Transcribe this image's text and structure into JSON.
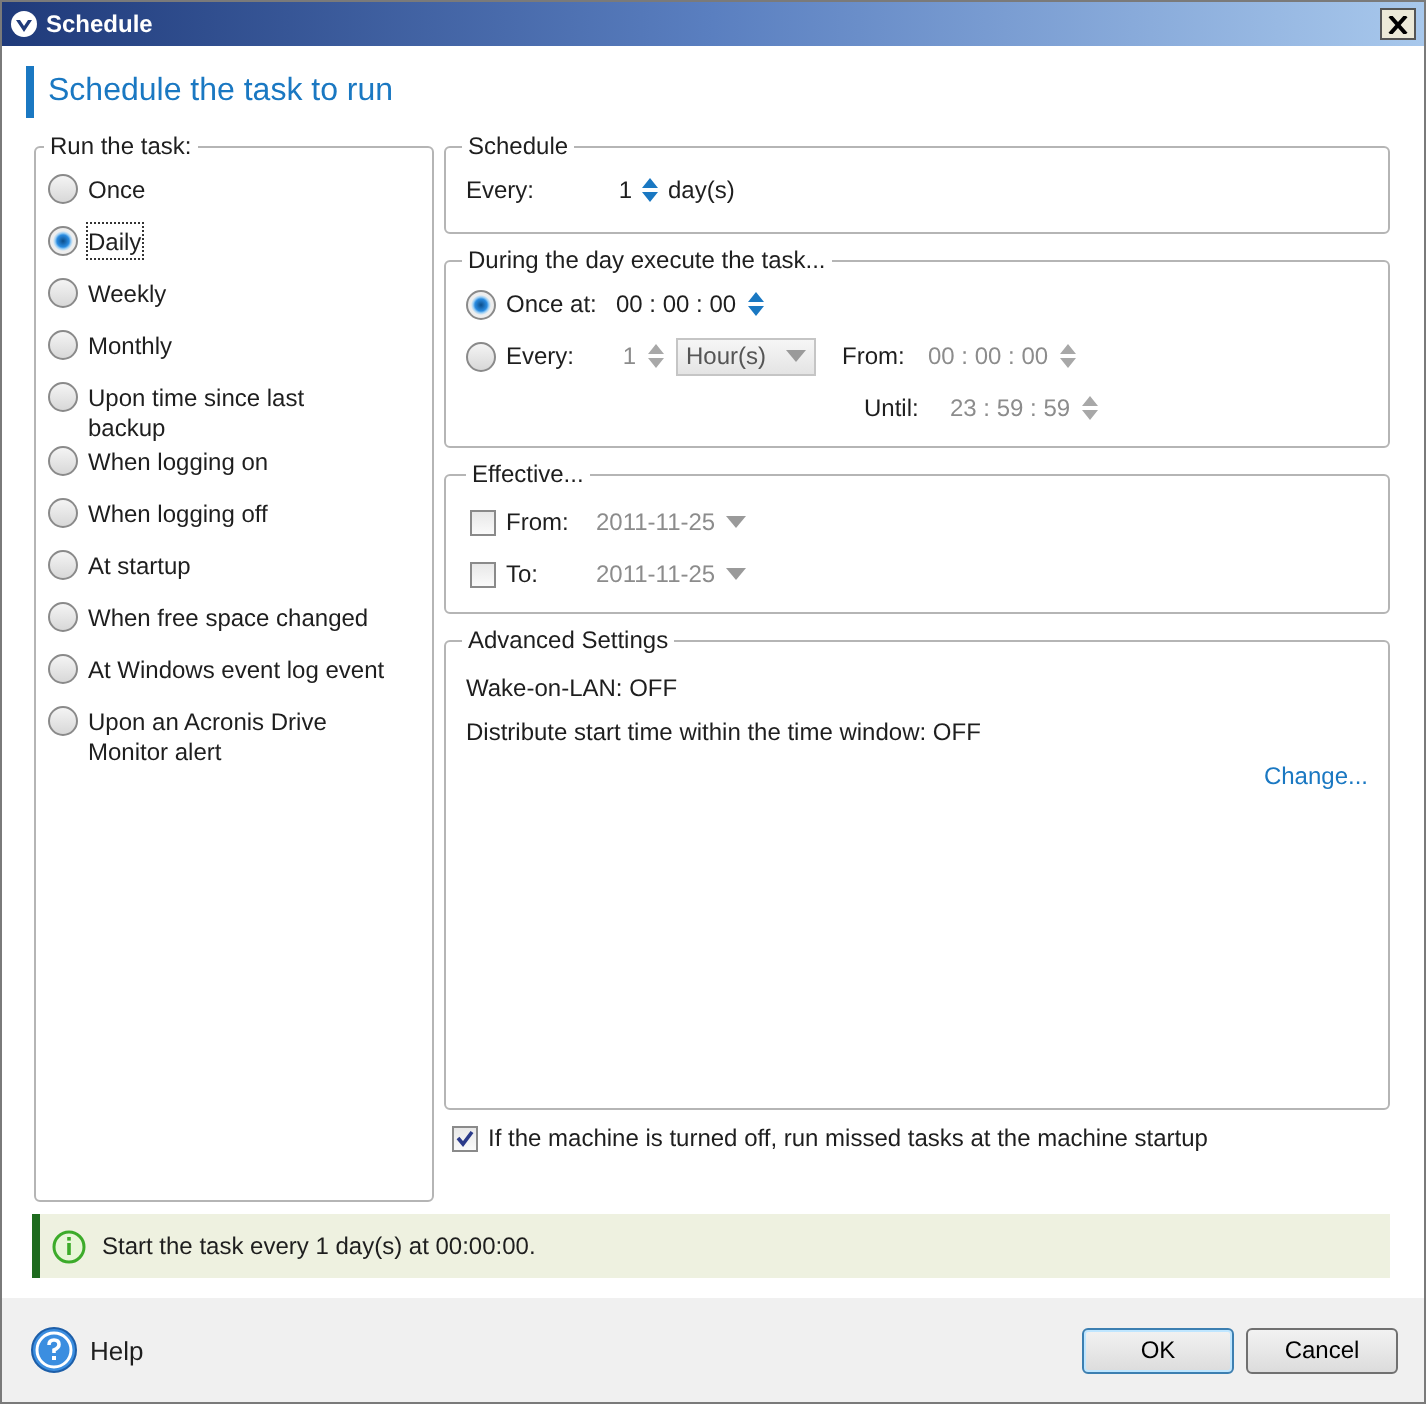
{
  "window": {
    "title": "Schedule"
  },
  "heading": "Schedule the task to run",
  "run_the_task": {
    "legend": "Run the task:",
    "options": [
      {
        "label": "Once",
        "selected": false
      },
      {
        "label": "Daily",
        "selected": true
      },
      {
        "label": "Weekly",
        "selected": false
      },
      {
        "label": "Monthly",
        "selected": false
      },
      {
        "label": "Upon time since last backup",
        "selected": false
      },
      {
        "label": "When logging on",
        "selected": false
      },
      {
        "label": "When logging off",
        "selected": false
      },
      {
        "label": "At startup",
        "selected": false
      },
      {
        "label": "When free space changed",
        "selected": false
      },
      {
        "label": "At Windows event log event",
        "selected": false
      },
      {
        "label": "Upon an Acronis Drive Monitor alert",
        "selected": false
      }
    ]
  },
  "schedule": {
    "legend": "Schedule",
    "every_label": "Every:",
    "every_value": "1",
    "unit": "day(s)"
  },
  "during_day": {
    "legend": "During the day execute the task...",
    "once_at": {
      "label": "Once at:",
      "selected": true,
      "time": "00 : 00 : 00"
    },
    "every": {
      "label": "Every:",
      "selected": false,
      "value": "1",
      "unit": "Hour(s)",
      "from_label": "From:",
      "from_time": "00 : 00 : 00",
      "until_label": "Until:",
      "until_time": "23 : 59 : 59"
    }
  },
  "effective": {
    "legend": "Effective...",
    "rows": [
      {
        "label": "From:",
        "checked": false,
        "date": "2011-11-25"
      },
      {
        "label": "To:",
        "checked": false,
        "date": "2011-11-25"
      }
    ]
  },
  "advanced": {
    "legend": "Advanced Settings",
    "lines": [
      "Wake-on-LAN: OFF",
      "Distribute start time within the time window: OFF"
    ],
    "link": "Change..."
  },
  "run_missed": {
    "label": "If the machine is turned off, run missed tasks at the machine startup",
    "checked": true
  },
  "summary": "Start the task every 1 day(s) at 00:00:00.",
  "footer": {
    "help": "Help",
    "buttons": [
      {
        "label": "OK",
        "kind": "default"
      },
      {
        "label": "Cancel",
        "kind": "normal"
      }
    ]
  }
}
